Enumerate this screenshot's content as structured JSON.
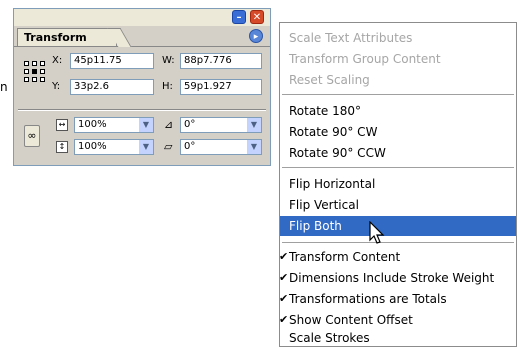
{
  "stray_char": "n",
  "panel": {
    "tab_label": "Transform",
    "x_label": "X:",
    "x_value": "45p11.75",
    "y_label": "Y:",
    "y_value": "33p2.6",
    "w_label": "W:",
    "w_value": "88p7.776",
    "h_label": "H:",
    "h_value": "59p1.927",
    "scale_x": "100%",
    "scale_y": "100%",
    "rotation": "0°",
    "shear": "0°",
    "min_glyph": "–",
    "close_glyph": "✕",
    "menu_glyph": "▸"
  },
  "menu": {
    "items": [
      {
        "label": "Scale Text Attributes",
        "disabled": true
      },
      {
        "label": "Transform Group Content",
        "disabled": true
      },
      {
        "label": "Reset Scaling",
        "disabled": true
      },
      {
        "label": "Rotate 180°"
      },
      {
        "label": "Rotate 90° CW"
      },
      {
        "label": "Rotate 90° CCW"
      },
      {
        "label": "Flip Horizontal"
      },
      {
        "label": "Flip Vertical"
      },
      {
        "label": "Flip Both",
        "highlighted": true
      },
      {
        "label": "Transform Content",
        "checked": true
      },
      {
        "label": "Dimensions Include Stroke Weight",
        "checked": true
      },
      {
        "label": "Transformations are Totals",
        "checked": true
      },
      {
        "label": "Show Content Offset",
        "checked": true
      },
      {
        "label": "Scale Strokes"
      }
    ],
    "check_glyph": "✔"
  }
}
